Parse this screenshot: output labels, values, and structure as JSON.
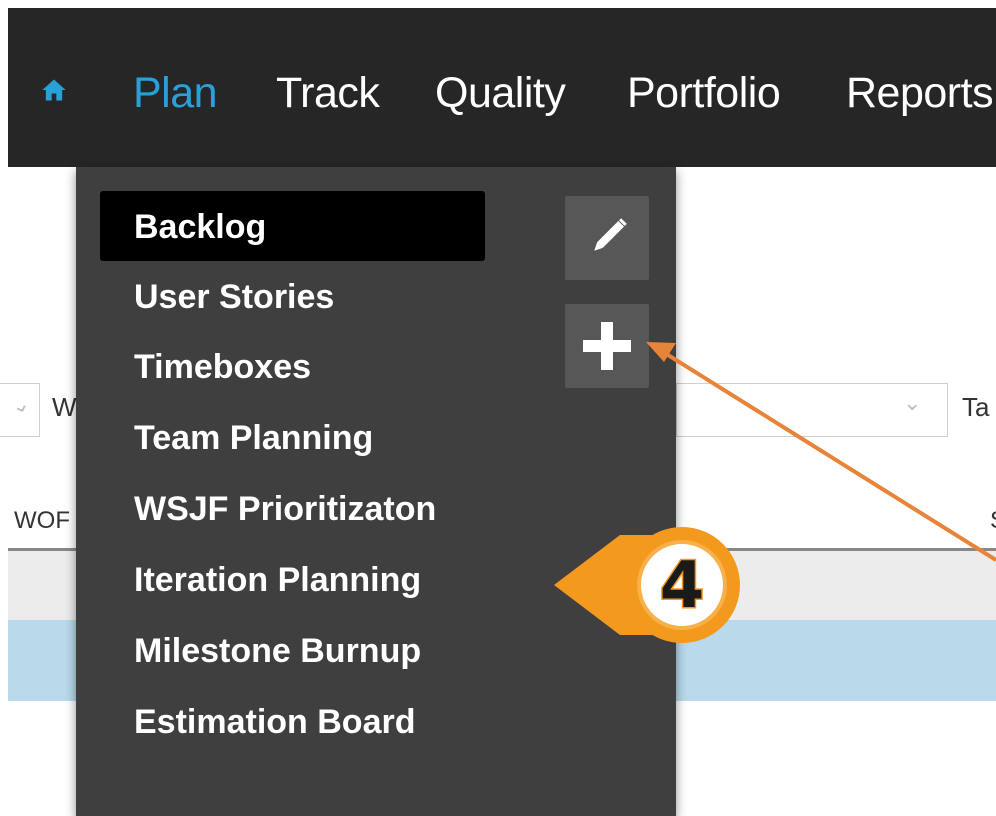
{
  "nav": {
    "items": [
      {
        "label": "Plan",
        "active": true
      },
      {
        "label": "Track",
        "active": false
      },
      {
        "label": "Quality",
        "active": false
      },
      {
        "label": "Portfolio",
        "active": false
      },
      {
        "label": "Reports",
        "active": false
      }
    ],
    "home_icon": "home-icon",
    "active_color": "#2aa0d8"
  },
  "dropdown": {
    "items": [
      {
        "label": "Backlog",
        "selected": true
      },
      {
        "label": "User Stories"
      },
      {
        "label": "Timeboxes"
      },
      {
        "label": "Team Planning"
      },
      {
        "label": "WSJF Prioritizaton"
      },
      {
        "label": "Iteration Planning"
      },
      {
        "label": "Milestone Burnup"
      },
      {
        "label": "Estimation Board"
      }
    ],
    "edit_icon": "pencil-icon",
    "add_icon": "plus-icon"
  },
  "background": {
    "filter_left_fragment": "W",
    "filter_right_fragment": "Ta",
    "column_fragment": "WOF",
    "column_right_fragment": "S"
  },
  "callout": {
    "number": "4",
    "color": "#f39a1e"
  }
}
